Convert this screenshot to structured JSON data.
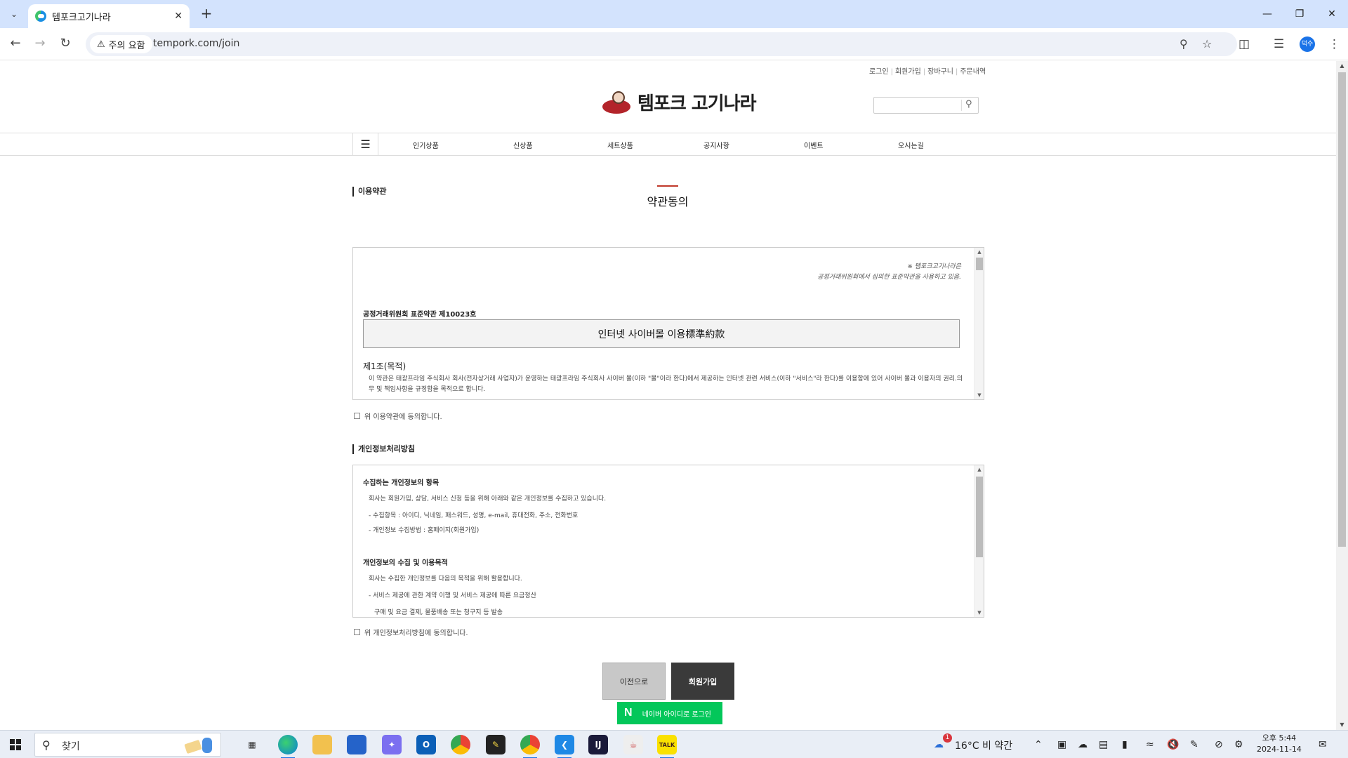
{
  "browser": {
    "tab_title": "템포크고기나라",
    "security_label": "주의 요함",
    "url": "tempork.com/join",
    "profile_initials": "덕수"
  },
  "site": {
    "util_links": [
      "로그인",
      "회원가입",
      "장바구니",
      "주문내역"
    ],
    "logo_text": "템포크 고기나라",
    "search_placeholder": "",
    "nav": [
      "인기상품",
      "신상품",
      "세트상품",
      "공지사항",
      "이벤트",
      "오시는길"
    ],
    "page_title": "약관동의"
  },
  "terms": {
    "section_title": "이용약관",
    "note_line1": "※ 템포크고기나라은",
    "note_line2": "공정거래위원회에서 심의한 표준약관을 사용하고 있음.",
    "standard_no": "공정거래위원회 표준약관 제10023호",
    "standard_title": "인터넷 사이버몰 이용標準約款",
    "article_title": "제1조(목적)",
    "article_body": "이 약관은 태광프라임 주식회사 회사(전자상거래 사업자)가 운영하는 태광프라임 주식회사 사이버 몰(이하 \"몰\"이라 한다)에서 제공하는 인터넷 관련 서비스(이하 \"서비스\"라 한다)를 이용함에 있어 사이버 몰과 이용자의 권리.의무 및 책임사항을 규정함을 목적으로 합니다.",
    "agree_label": "위 이용약관에 동의합니다."
  },
  "privacy": {
    "section_title": "개인정보처리방침",
    "h1": "수집하는 개인정보의 항목",
    "p1": "회사는 회원가입, 상담, 서비스 신청 등을 위해 아래와 같은 개인정보를 수집하고 있습니다.",
    "li1": "- 수집항목 : 아이디, 닉네임, 패스워드, 성명, e-mail, 휴대전화, 주소, 전화번호",
    "li2": "- 개인정보 수집방법 : 홈페이지(회원가입)",
    "h2": "개인정보의 수집 및 이용목적",
    "p2": "회사는 수집한 개인정보를 다음의 목적을 위해 활용합니다.",
    "li3": "- 서비스 제공에 관한 계약 이행 및 서비스 제공에 따른 요금정산",
    "li4": "구매 및 요금 결제, 물품배송 또는 청구지 등 발송",
    "agree_label": "위 개인정보처리방침에 동의합니다."
  },
  "buttons": {
    "prev": "이전으로",
    "join": "회원가입",
    "naver": "네이버 아이디로 로그인",
    "naver_logo": "N"
  },
  "taskbar": {
    "search_label": "찾기",
    "weather": "16°C  비 약간",
    "time": "오후 5:44",
    "date": "2024-11-14",
    "notification_count": "1"
  },
  "colors": {
    "accent_red": "#c0392b",
    "naver_green": "#03c75a",
    "join_button": "#3a3a3a",
    "browser_frame": "#d3e3fd"
  }
}
